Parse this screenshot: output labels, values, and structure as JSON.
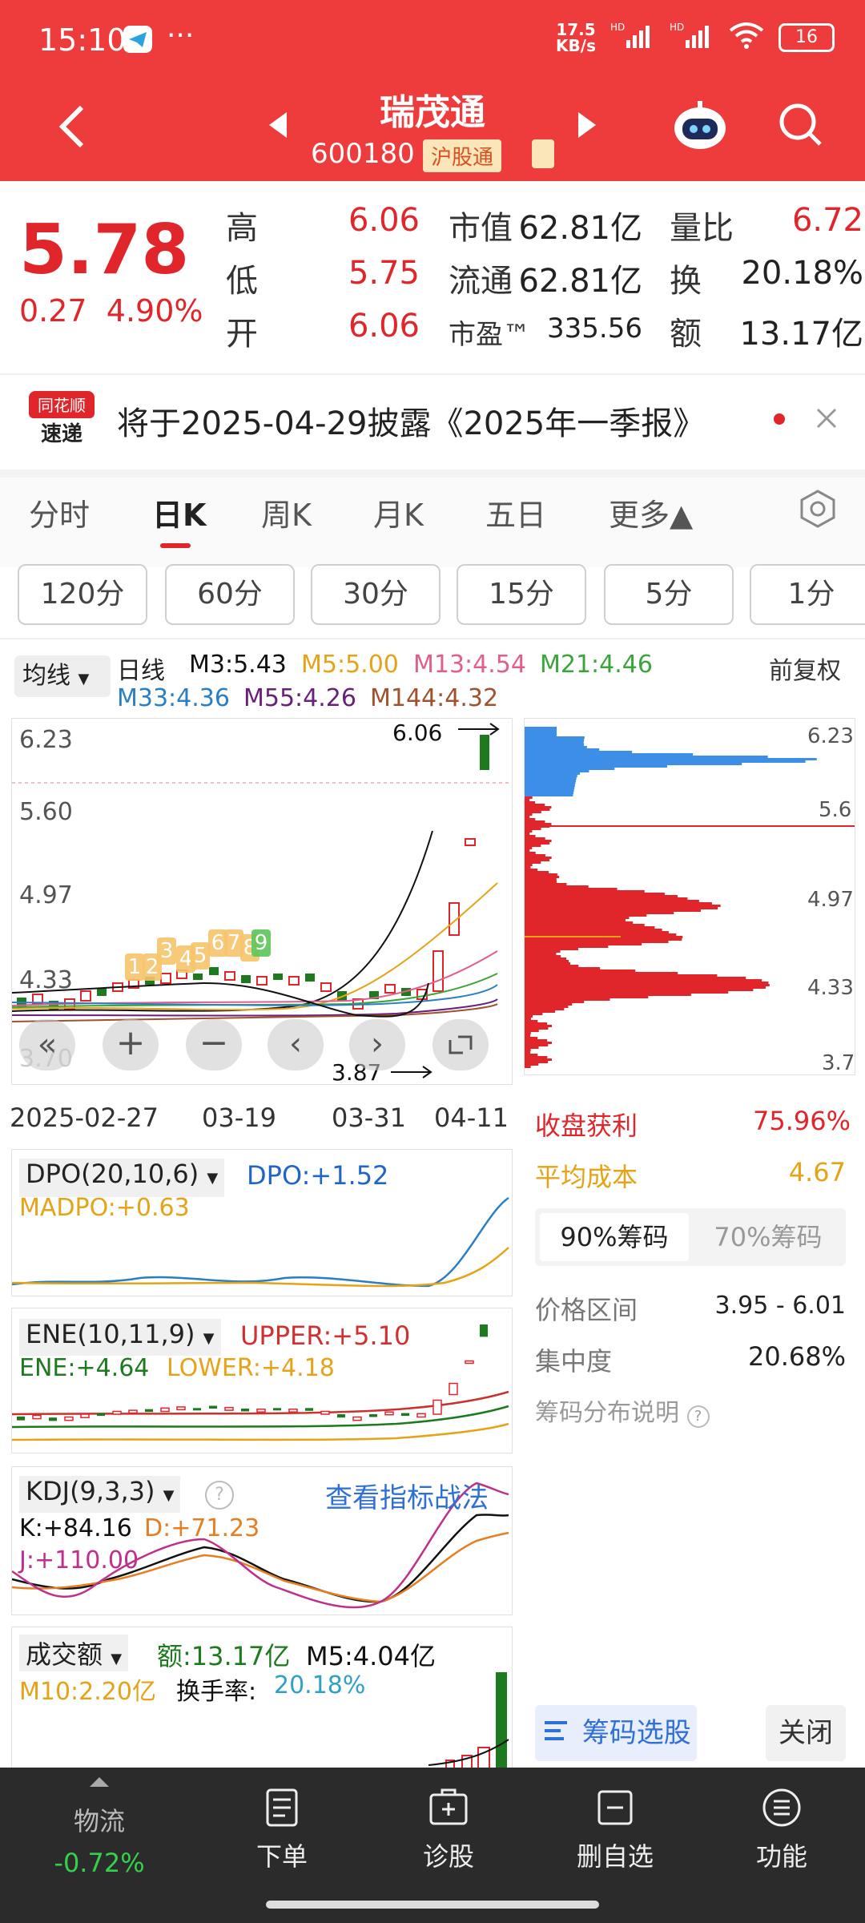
{
  "status": {
    "time": "15:10",
    "net_speed_top": "17.5",
    "net_speed_bottom": "KB/s",
    "signal1": "HD",
    "signal2": "HD",
    "battery": "16"
  },
  "header": {
    "title": "瑞茂通",
    "code": "600180",
    "tag": "沪股通"
  },
  "quote": {
    "price": "5.78",
    "change": "0.27",
    "change_pct": "4.90%",
    "high_label": "高",
    "high": "6.06",
    "low_label": "低",
    "low": "5.75",
    "open_label": "开",
    "open": "6.06",
    "mcap_label": "市值",
    "mcap": "62.81亿",
    "float_label": "流通",
    "float": "62.81亿",
    "pe_label": "市盈™",
    "pe": "335.56",
    "vol_ratio_label": "量比",
    "vol_ratio": "6.72",
    "turnover_label": "换",
    "turnover": "20.18%",
    "amount_label": "额",
    "amount": "13.17亿"
  },
  "notice": {
    "logo_line1": "同花顺",
    "logo_line2": "速递",
    "text": "将于2025-04-29披露《2025年一季报》"
  },
  "period_tabs": [
    {
      "label": "分时"
    },
    {
      "label": "日K"
    },
    {
      "label": "周K"
    },
    {
      "label": "月K"
    },
    {
      "label": "五日"
    },
    {
      "label": "更多▲"
    }
  ],
  "minute_buttons": [
    "120分",
    "60分",
    "30分",
    "15分",
    "5分",
    "1分"
  ],
  "ma_legend": {
    "selector": "均线",
    "day": "日线",
    "m3": "M3:5.43",
    "m5": "M5:5.00",
    "m13": "M13:4.54",
    "m21": "M21:4.46",
    "m33": "M33:4.36",
    "m55": "M55:4.26",
    "m144": "M144:4.32",
    "adjust": "前复权"
  },
  "colors": {
    "up": "#e0252b",
    "down": "#1e7a1e",
    "m3": "#111111",
    "m5": "#e6a317",
    "m13": "#e35d8c",
    "m21": "#3aa53a",
    "m33": "#2a7fc4",
    "m55": "#6a1f7a",
    "m144": "#a0522d",
    "chip_blue": "#3d8ee6"
  },
  "kline": {
    "y_ticks": [
      "6.23",
      "5.60",
      "4.97",
      "4.33",
      "3.70"
    ],
    "x_ticks": [
      "2025-02-27",
      "03-19",
      "03-31",
      "04-11"
    ],
    "high_marker": "6.06",
    "low_marker": "3.87",
    "signal_numbers": [
      "1",
      "2",
      "3",
      "4",
      "5",
      "6",
      "7",
      "8",
      "9"
    ]
  },
  "chip": {
    "y_ticks": [
      "6.23",
      "5.6",
      "4.97",
      "4.33",
      "3.7"
    ],
    "profit_label": "收盘获利",
    "profit_value": "75.96%",
    "avg_cost_label": "平均成本",
    "avg_cost_value": "4.67",
    "tab_90": "90%筹码",
    "tab_70": "70%筹码",
    "range_label": "价格区间",
    "range_value": "3.95 - 6.01",
    "concentration_label": "集中度",
    "concentration_value": "20.68%",
    "explain": "筹码分布说明",
    "select_button": "筹码选股",
    "close_button": "关闭"
  },
  "dpo": {
    "name": "DPO(20,10,6)",
    "dpo": "DPO:+1.52",
    "madpo": "MADPO:+0.63"
  },
  "ene": {
    "name": "ENE(10,11,9)",
    "upper": "UPPER:+5.10",
    "ene": "ENE:+4.64",
    "lower": "LOWER:+4.18"
  },
  "kdj": {
    "name": "KDJ(9,3,3)",
    "link": "查看指标战法",
    "k": "K:+84.16",
    "d": "D:+71.23",
    "j": "J:+110.00"
  },
  "volume": {
    "name": "成交额",
    "amount": "额:13.17亿",
    "m5": "M5:4.04亿",
    "m10": "M10:2.20亿",
    "turnover_label": "换手率:",
    "turnover": "20.18%"
  },
  "bottom_bar": [
    {
      "label": "物流",
      "sub": "-0.72%"
    },
    {
      "label": "下单"
    },
    {
      "label": "诊股"
    },
    {
      "label": "删自选"
    },
    {
      "label": "功能"
    }
  ]
}
